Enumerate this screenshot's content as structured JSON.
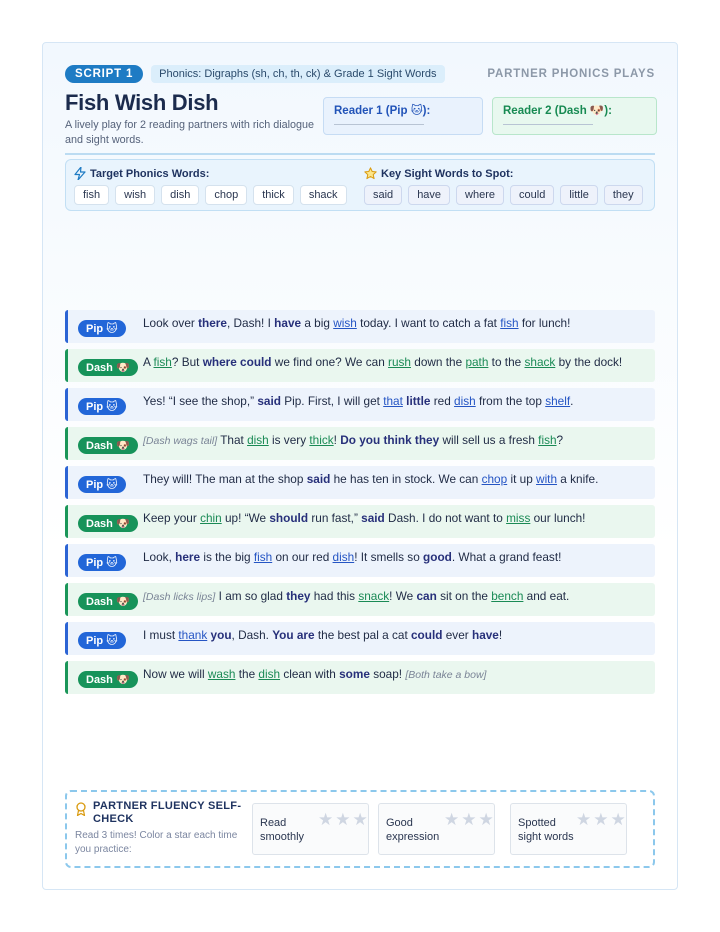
{
  "header": {
    "script_label": "SCRIPT 1",
    "topic": "Phonics: Digraphs (sh, ch, th, ck) & Grade 1 Sight Words",
    "series": "PARTNER PHONICS PLAYS",
    "title": "Fish Wish Dish",
    "subtitle": "A lively play for 2 reading partners with rich dialogue and sight words."
  },
  "readers": {
    "reader1": "Reader 1 (Pip 🐱):",
    "reader2": "Reader 2 (Dash 🐶):"
  },
  "target_words": {
    "heading": "Target Phonics Words:",
    "items": [
      "fish",
      "wish",
      "dish",
      "chop",
      "thick",
      "shack"
    ]
  },
  "sight_words": {
    "heading": "Key Sight Words to Spot:",
    "items": [
      "said",
      "have",
      "where",
      "could",
      "little",
      "they"
    ]
  },
  "speakers": {
    "pip": "Pip 🐱",
    "dash": "Dash 🐶"
  },
  "script": [
    {
      "speaker": "pip",
      "parts": [
        {
          "t": "Look over "
        },
        {
          "t": "there",
          "k": "sw"
        },
        {
          "t": ", Dash! I "
        },
        {
          "t": "have",
          "k": "sw"
        },
        {
          "t": " a big "
        },
        {
          "t": "wish",
          "k": "ph"
        },
        {
          "t": " today. I want to catch a fat "
        },
        {
          "t": "fish",
          "k": "ph"
        },
        {
          "t": " for lunch!"
        }
      ]
    },
    {
      "speaker": "dash",
      "parts": [
        {
          "t": "A "
        },
        {
          "t": "fish",
          "k": "ph"
        },
        {
          "t": "? But "
        },
        {
          "t": "where could",
          "k": "sw"
        },
        {
          "t": " we find one? We can "
        },
        {
          "t": "rush",
          "k": "ph"
        },
        {
          "t": " down the "
        },
        {
          "t": "path",
          "k": "ph"
        },
        {
          "t": " to the "
        },
        {
          "t": "shack",
          "k": "ph"
        },
        {
          "t": " by the dock!"
        }
      ]
    },
    {
      "speaker": "pip",
      "parts": [
        {
          "t": "Yes! “I see the shop,” "
        },
        {
          "t": "said",
          "k": "sw"
        },
        {
          "t": " Pip. First, I will get "
        },
        {
          "t": "that",
          "k": "ph"
        },
        {
          "t": " "
        },
        {
          "t": "little",
          "k": "sw"
        },
        {
          "t": " red "
        },
        {
          "t": "dish",
          "k": "ph"
        },
        {
          "t": " from the top "
        },
        {
          "t": "shelf",
          "k": "ph"
        },
        {
          "t": "."
        }
      ]
    },
    {
      "speaker": "dash",
      "parts": [
        {
          "t": "[Dash wags tail]",
          "k": "stage"
        },
        {
          "t": "  That "
        },
        {
          "t": "dish",
          "k": "ph"
        },
        {
          "t": " is very "
        },
        {
          "t": "thick",
          "k": "ph"
        },
        {
          "t": "! "
        },
        {
          "t": "Do you think they",
          "k": "sw"
        },
        {
          "t": " will sell us a fresh "
        },
        {
          "t": "fish",
          "k": "ph"
        },
        {
          "t": "?"
        }
      ]
    },
    {
      "speaker": "pip",
      "parts": [
        {
          "t": "They will! The man at the shop "
        },
        {
          "t": "said",
          "k": "sw"
        },
        {
          "t": " he has ten in stock. We can "
        },
        {
          "t": "chop",
          "k": "ph"
        },
        {
          "t": " it up "
        },
        {
          "t": "with",
          "k": "ph"
        },
        {
          "t": " a knife."
        }
      ]
    },
    {
      "speaker": "dash",
      "parts": [
        {
          "t": "Keep your "
        },
        {
          "t": "chin",
          "k": "ph"
        },
        {
          "t": " up! “We "
        },
        {
          "t": "should",
          "k": "sw"
        },
        {
          "t": " run fast,” "
        },
        {
          "t": "said",
          "k": "sw"
        },
        {
          "t": " Dash. I do not want to "
        },
        {
          "t": "miss",
          "k": "ph"
        },
        {
          "t": " our lunch!"
        }
      ]
    },
    {
      "speaker": "pip",
      "parts": [
        {
          "t": "Look, "
        },
        {
          "t": "here",
          "k": "sw"
        },
        {
          "t": " is the big "
        },
        {
          "t": "fish",
          "k": "ph"
        },
        {
          "t": " on our red "
        },
        {
          "t": "dish",
          "k": "ph"
        },
        {
          "t": "! It smells so "
        },
        {
          "t": "good",
          "k": "sw"
        },
        {
          "t": ". What a grand feast!"
        }
      ]
    },
    {
      "speaker": "dash",
      "parts": [
        {
          "t": "[Dash licks lips]",
          "k": "stage"
        },
        {
          "t": "  I am so glad "
        },
        {
          "t": "they",
          "k": "sw"
        },
        {
          "t": " had this "
        },
        {
          "t": "snack",
          "k": "ph"
        },
        {
          "t": "! We "
        },
        {
          "t": "can",
          "k": "sw"
        },
        {
          "t": " sit on the "
        },
        {
          "t": "bench",
          "k": "ph"
        },
        {
          "t": " and eat."
        }
      ]
    },
    {
      "speaker": "pip",
      "parts": [
        {
          "t": "I must "
        },
        {
          "t": "thank",
          "k": "ph"
        },
        {
          "t": " "
        },
        {
          "t": "you",
          "k": "sw"
        },
        {
          "t": ", Dash. "
        },
        {
          "t": "You are",
          "k": "sw"
        },
        {
          "t": " the best pal a cat "
        },
        {
          "t": "could",
          "k": "sw"
        },
        {
          "t": " ever "
        },
        {
          "t": "have",
          "k": "sw"
        },
        {
          "t": "!"
        }
      ]
    },
    {
      "speaker": "dash",
      "parts": [
        {
          "t": "Now we will "
        },
        {
          "t": "wash",
          "k": "ph"
        },
        {
          "t": " the "
        },
        {
          "t": "dish",
          "k": "ph"
        },
        {
          "t": " clean with "
        },
        {
          "t": "some",
          "k": "sw"
        },
        {
          "t": " soap! "
        },
        {
          "t": "[Both take a bow]",
          "k": "stage"
        }
      ]
    }
  ],
  "self_check": {
    "title": "PARTNER FLUENCY SELF-CHECK",
    "subtitle": "Read 3 times! Color a star each time you practice:",
    "items": [
      "Read smoothly",
      "Good expression",
      "Spotted sight words"
    ]
  },
  "colors": {
    "accent": "#1e7bc4",
    "pip": "#2266d8",
    "dash": "#17935a",
    "sight_word": "#27307a"
  }
}
